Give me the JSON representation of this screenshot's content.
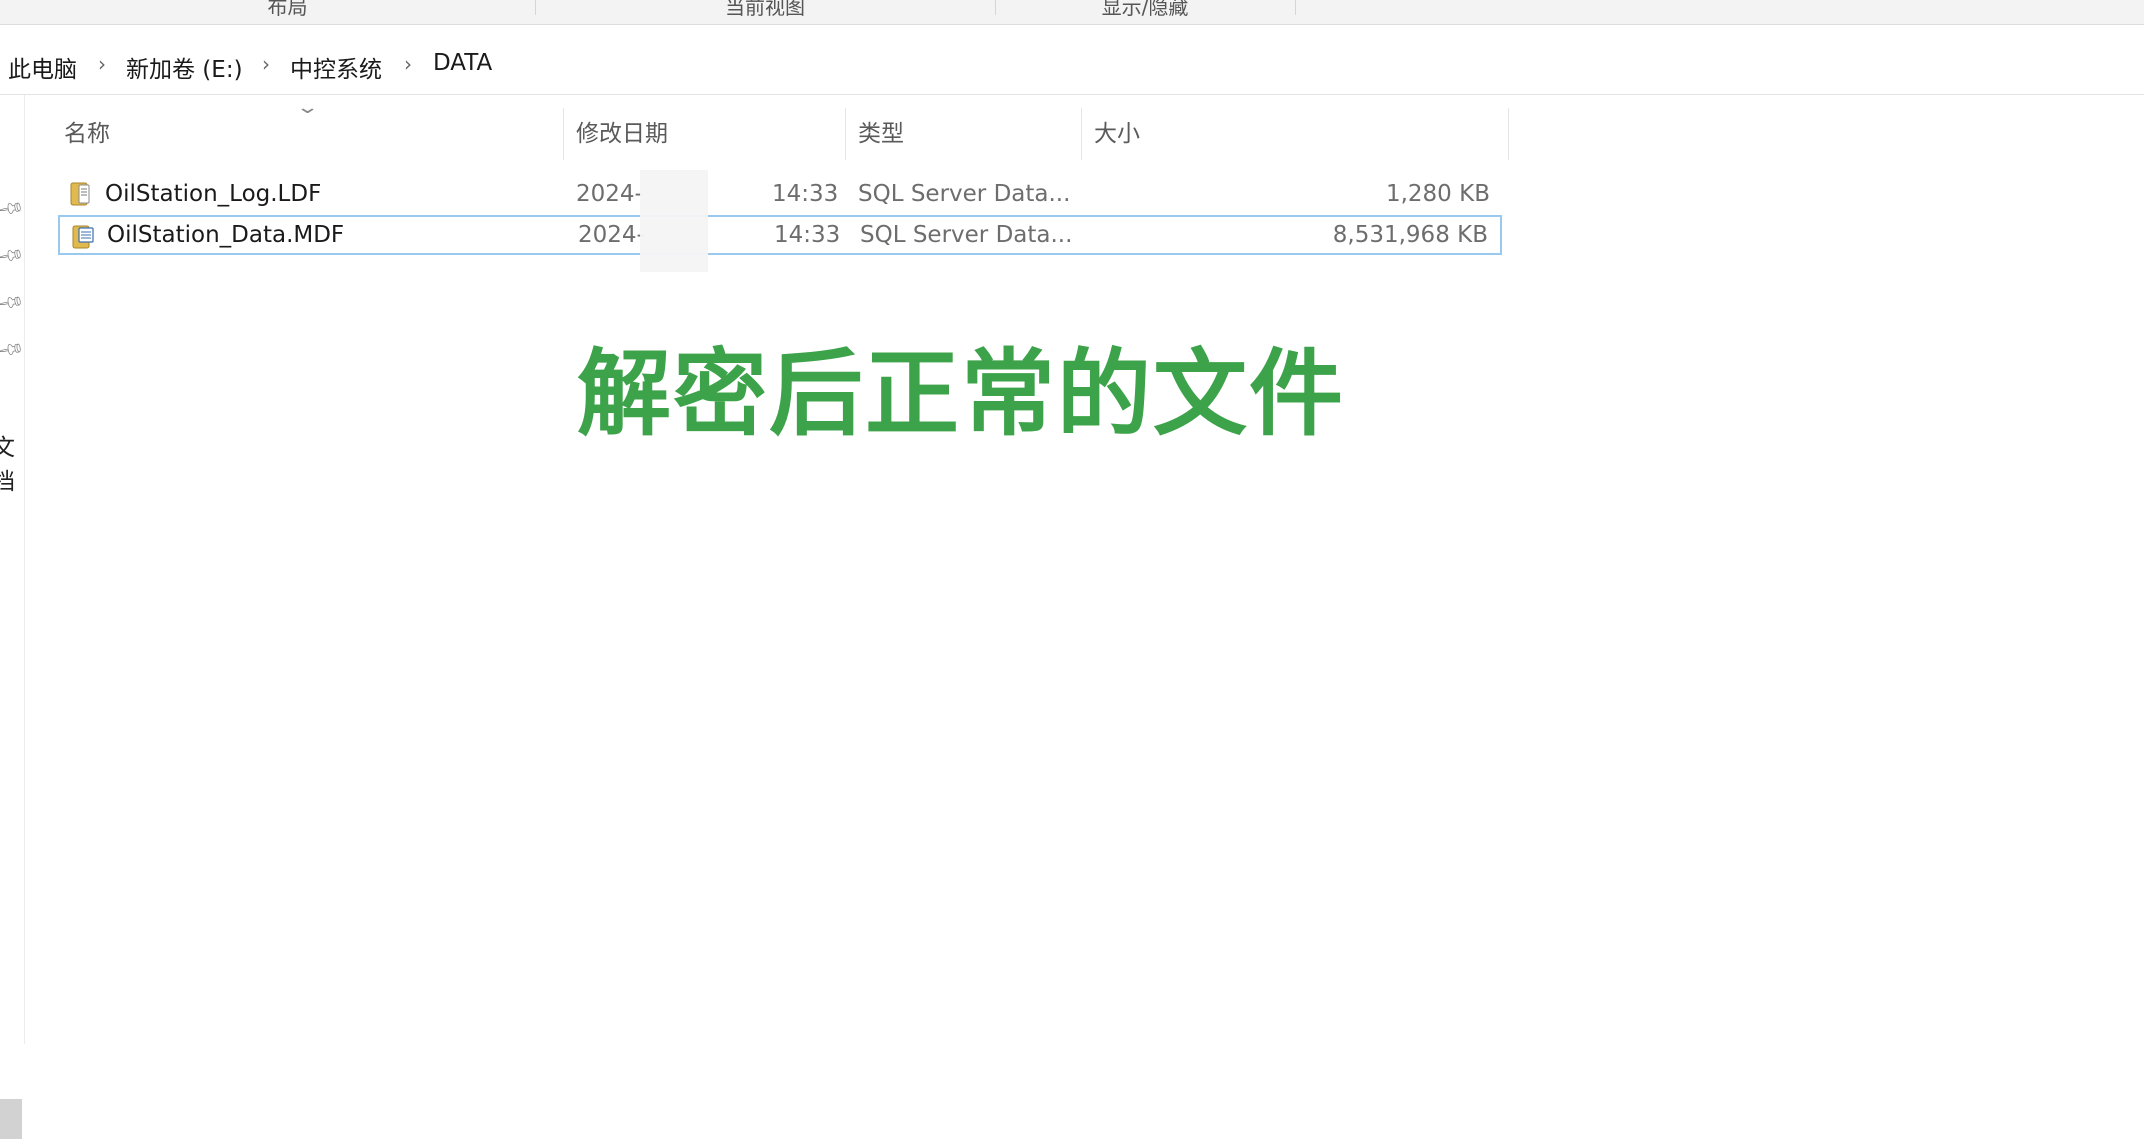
{
  "ribbon": {
    "groups": [
      "布局",
      "当前视图",
      "显示/隐藏"
    ]
  },
  "breadcrumb": {
    "items": [
      "此电脑",
      "新加卷 (E:)",
      "中控系统",
      "DATA"
    ]
  },
  "nav_pane": {
    "partial_label": "文档"
  },
  "columns": {
    "name": "名称",
    "date": "修改日期",
    "type": "类型",
    "size": "大小"
  },
  "files": [
    {
      "name": "OilStation_Log.LDF",
      "date": "2024-",
      "time": "14:33",
      "type": "SQL Server Data...",
      "size": "1,280 KB",
      "icon": "sql-database-file-icon"
    },
    {
      "name": "OilStation_Data.MDF",
      "date": "2024-",
      "time": "14:33",
      "type": "SQL Server Data...",
      "size": "8,531,968 KB",
      "icon": "sql-database-file-icon",
      "selected": true
    }
  ],
  "overlay": {
    "caption": "解密后正常的文件"
  },
  "colors": {
    "caption_green": "#3da34a",
    "selection_border": "#99c9ef"
  }
}
